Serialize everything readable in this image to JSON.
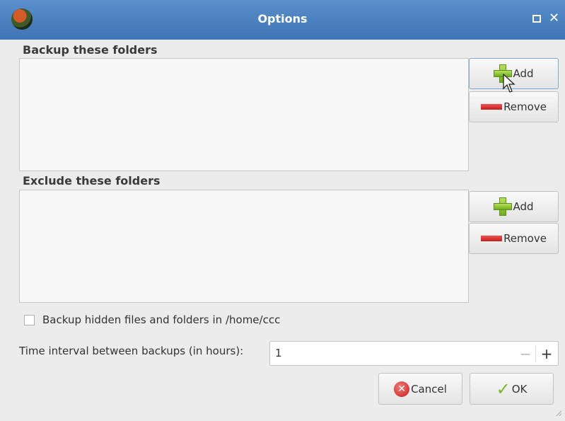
{
  "window": {
    "title": "Options",
    "maximize_icon": "maximize-icon",
    "close_icon": "close-icon",
    "close_glyph": "✕"
  },
  "backup_section": {
    "label": "Backup these folders",
    "items": [],
    "add_label": "Add",
    "remove_label": "Remove"
  },
  "exclude_section": {
    "label": "Exclude these folders",
    "items": [],
    "add_label": "Add",
    "remove_label": "Remove"
  },
  "hidden_files": {
    "label": "Backup hidden files and folders in /home/ccc",
    "checked": false
  },
  "interval": {
    "label": "Time interval between backups (in hours):",
    "value": "1",
    "minus": "−",
    "plus": "+"
  },
  "footer": {
    "cancel_label": "Cancel",
    "ok_label": "OK"
  },
  "colors": {
    "titlebar": "#4a82c4",
    "add_icon": "#8cc43a",
    "remove_icon": "#d72a2a",
    "cancel_icon": "#d9302e",
    "ok_icon": "#7bb62a"
  }
}
